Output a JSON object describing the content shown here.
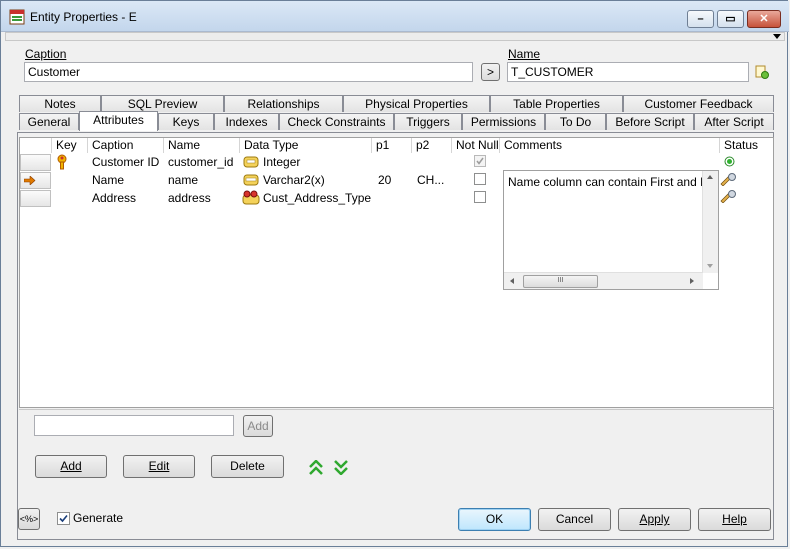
{
  "window": {
    "title": "Entity Properties - E"
  },
  "caption": {
    "label": "Caption",
    "value": "Customer"
  },
  "name": {
    "label": "Name",
    "value": "T_CUSTOMER"
  },
  "copy_button_label": ">",
  "tabs_row1": [
    "Notes",
    "SQL Preview",
    "Relationships",
    "Physical Properties",
    "Table Properties",
    "Customer Feedback"
  ],
  "tabs_row2": [
    "General",
    "Attributes",
    "Keys",
    "Indexes",
    "Check Constraints",
    "Triggers",
    "Permissions",
    "To Do",
    "Before Script",
    "After Script"
  ],
  "active_tab": "Attributes",
  "columns": [
    "Key",
    "Caption",
    "Name",
    "Data Type",
    "p1",
    "p2",
    "Not Null",
    "Comments",
    "Status"
  ],
  "rows": [
    {
      "caption": "Customer ID",
      "name": "customer_id",
      "data_type": "Integer",
      "p1": "",
      "p2": "",
      "not_null": true,
      "comments": "",
      "key": true
    },
    {
      "caption": "Name",
      "name": "name",
      "data_type": "Varchar2(x)",
      "p1": "20",
      "p2": "CH...",
      "not_null": false,
      "comments": "Name column can contain First and Midd",
      "current": true
    },
    {
      "caption": "Address",
      "name": "address",
      "data_type": "Cust_Address_Type",
      "p1": "",
      "p2": "",
      "not_null": false,
      "comments": ""
    }
  ],
  "new_attribute": {
    "value": "",
    "add_label": "Add"
  },
  "buttons": {
    "add": "Add",
    "edit": "Edit",
    "delete": "Delete"
  },
  "footer": {
    "generate_label": "Generate",
    "generate_checked": true,
    "ok": "OK",
    "cancel": "Cancel",
    "apply": "Apply",
    "help": "Help",
    "sql_label": "<%>"
  },
  "memo_scroll_glyph": "III"
}
